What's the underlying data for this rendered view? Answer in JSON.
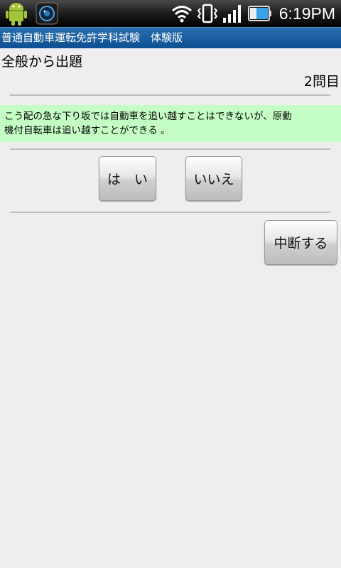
{
  "status_bar": {
    "time": "6:19PM",
    "icons": [
      "android-icon",
      "camera-app-icon",
      "wifi-icon",
      "vibrate-icon",
      "signal-icon",
      "battery-icon"
    ]
  },
  "app": {
    "title": "普通自動車運転免許学科試験　体験版"
  },
  "quiz": {
    "category": "全般から出題",
    "question_number": "2問目",
    "question_line1": "こう配の急な下り坂では自動車を追い越すことはできないが、原動",
    "question_line2": "機付自転車は追い越すことができる 。",
    "yes_label": "は　い",
    "no_label": "いいえ",
    "suspend_label": "中断する"
  },
  "colors": {
    "title_bar": "#1565a8",
    "question_background": "#c6ffc6",
    "page_background": "#eeeeee"
  }
}
